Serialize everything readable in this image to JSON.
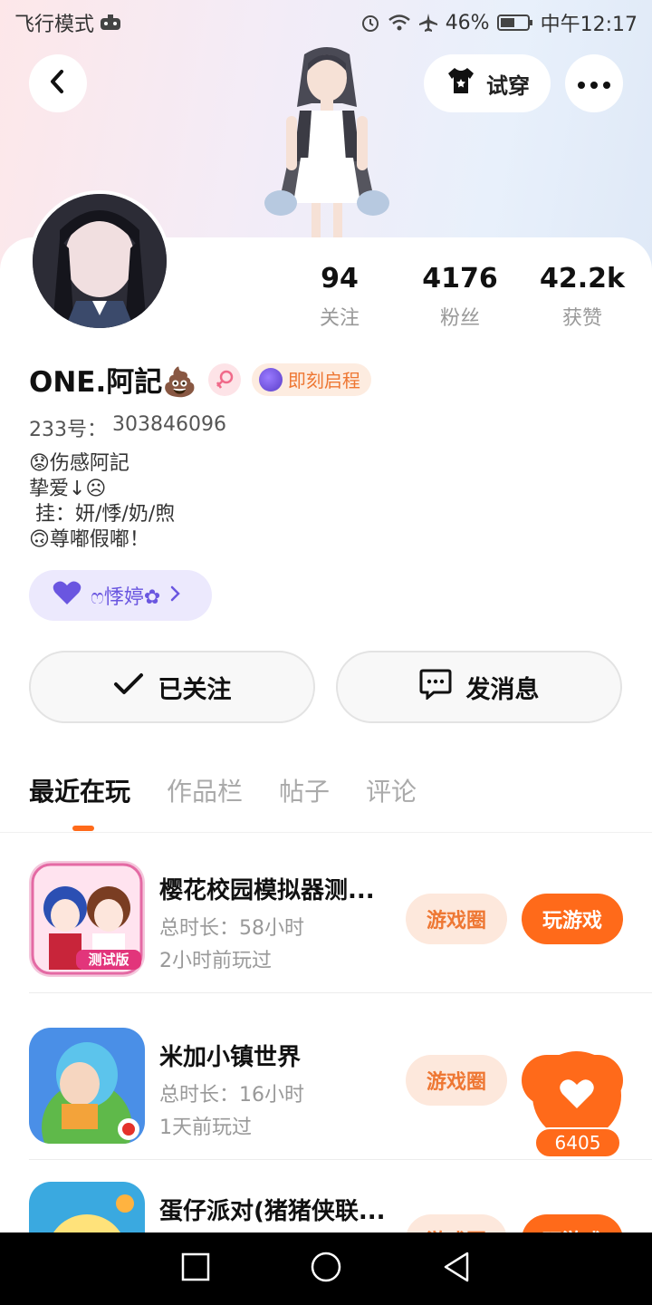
{
  "status_bar": {
    "mode": "飞行模式",
    "battery": "46%",
    "time": "中午12:17"
  },
  "header": {
    "try_on_label": "试穿"
  },
  "stats": [
    {
      "value": "94",
      "label": "关注"
    },
    {
      "value": "4176",
      "label": "粉丝"
    },
    {
      "value": "42.2k",
      "label": "获赞"
    }
  ],
  "profile": {
    "name": "ONE.阿記💩",
    "tag_label": "即刻启程",
    "uid_label": "233号：",
    "uid_value": "303846096",
    "bio": [
      "😟伤感阿記",
      "挚爱↓☹",
      " 挂：妍/悸/奶/煦",
      "🙃尊嘟假嘟！"
    ],
    "club_label": "ෆ悸婷✿"
  },
  "actions": {
    "follow_label": "已关注",
    "message_label": "发消息"
  },
  "tabs": [
    {
      "label": "最近在玩",
      "active": true
    },
    {
      "label": "作品栏",
      "active": false
    },
    {
      "label": "帖子",
      "active": false
    },
    {
      "label": "评论",
      "active": false
    }
  ],
  "games": [
    {
      "title": "樱花校园模拟器测...",
      "duration": "总时长：58小时",
      "last_played": "2小时前玩过",
      "circle_label": "游戏圈",
      "play_label": "玩游戏"
    },
    {
      "title": "米加小镇世界",
      "duration": "总时长：16小时",
      "last_played": "1天前玩过",
      "circle_label": "游戏圈",
      "play_label": "玩游戏"
    },
    {
      "title": "蛋仔派对(猪猪侠联...",
      "duration": "",
      "last_played": "",
      "circle_label": "游戏圈",
      "play_label": "玩游戏"
    }
  ],
  "like_float": {
    "count": "6405"
  },
  "icons": [
    "airplane-mode-icon",
    "alarm-icon",
    "wifi-icon",
    "battery-icon",
    "back-icon",
    "tshirt-icon",
    "more-icon",
    "female-icon",
    "heart-icon",
    "chevron-right-icon",
    "check-icon",
    "chat-icon",
    "square-nav-icon",
    "circle-nav-icon",
    "triangle-nav-icon"
  ],
  "colors": {
    "accent": "#ff6a1a",
    "accent_soft": "#fde8dc",
    "club_bg": "#ece9fd",
    "club_text": "#6a56e0"
  }
}
